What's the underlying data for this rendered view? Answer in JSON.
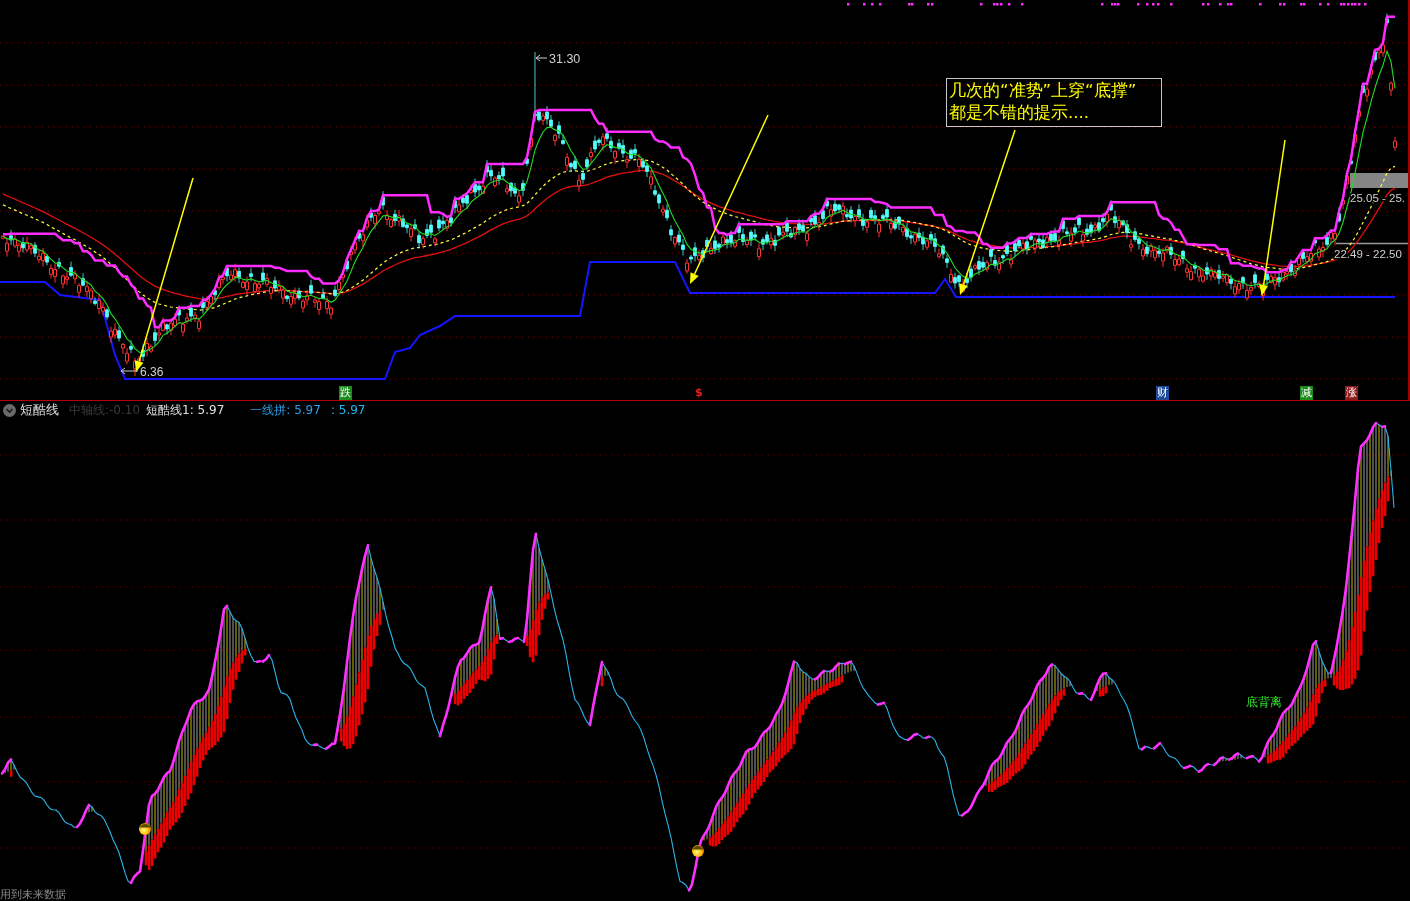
{
  "upper_panel": {
    "price_labels": [
      {
        "kind": "peak",
        "text": "31.30"
      },
      {
        "kind": "trough",
        "text": "6.36"
      },
      {
        "kind": "range",
        "text": "25.05 - 25."
      },
      {
        "kind": "range",
        "text": "22.49 - 22.50"
      }
    ],
    "annotation": {
      "lines": [
        "几次的“准势”上穿“底撑”",
        "都是不错的提示...."
      ]
    },
    "signals": [
      {
        "kind": "tile",
        "text": "跌",
        "color": "#1c8c1c"
      },
      {
        "kind": "plain",
        "text": "$",
        "color": "#e02020"
      },
      {
        "kind": "tile",
        "text": "财",
        "color": "#1e4a9a"
      },
      {
        "kind": "tile",
        "text": "减",
        "color": "#1c8c1c"
      },
      {
        "kind": "tile",
        "text": "涨",
        "color": "#8c1c1c"
      }
    ]
  },
  "lower_panel": {
    "legend": {
      "title": "短酷线",
      "items": [
        {
          "text": "中轴线:-0.10",
          "color": "#3c3c3c"
        },
        {
          "text": "短酷线1: 5.97",
          "color": "#e0e0e0"
        },
        {
          "text": "一线拼: 5.97",
          "color": "#2aa0f0"
        },
        {
          "text": ": 5.97",
          "color": "#22b8f0"
        }
      ]
    },
    "marker_label": "底背离"
  },
  "footer_note": "用到未来数据"
}
